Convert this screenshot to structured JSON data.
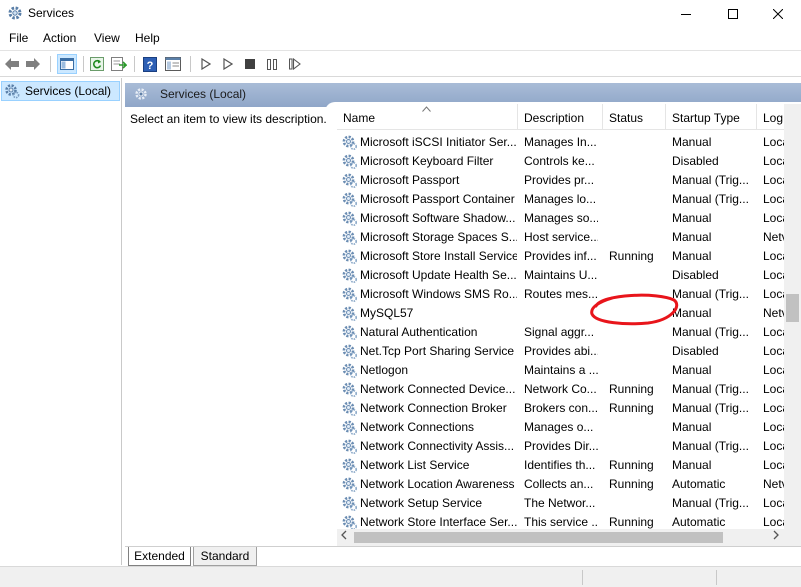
{
  "window": {
    "title": "Services",
    "controls": [
      "minimize",
      "maximize",
      "close"
    ]
  },
  "menu": {
    "items": [
      "File",
      "Action",
      "View",
      "Help"
    ]
  },
  "toolbar": {
    "icons": [
      "back-icon",
      "forward-icon",
      "show-hide-console-tree-icon",
      "refresh-icon",
      "export-list-icon",
      "help-icon",
      "properties-icon",
      "start-service-icon",
      "start-service-alt-icon",
      "stop-service-icon",
      "pause-service-icon",
      "restart-service-icon"
    ]
  },
  "tree": {
    "items": [
      {
        "label": "Services (Local)"
      }
    ]
  },
  "pane": {
    "header": "Services (Local)",
    "description": "Select an item to view its description."
  },
  "list": {
    "columns": [
      "Name",
      "Description",
      "Status",
      "Startup Type",
      "Log"
    ],
    "rows": [
      {
        "name": "Microsoft iSCSI Initiator Ser...",
        "description": "Manages In...",
        "status": "",
        "startup": "Manual",
        "log": "Loca"
      },
      {
        "name": "Microsoft Keyboard Filter",
        "description": "Controls ke...",
        "status": "",
        "startup": "Disabled",
        "log": "Loca"
      },
      {
        "name": "Microsoft Passport",
        "description": "Provides pr...",
        "status": "",
        "startup": "Manual (Trig...",
        "log": "Loca"
      },
      {
        "name": "Microsoft Passport Container",
        "description": "Manages lo...",
        "status": "",
        "startup": "Manual (Trig...",
        "log": "Loca"
      },
      {
        "name": "Microsoft Software Shadow...",
        "description": "Manages so...",
        "status": "",
        "startup": "Manual",
        "log": "Loca"
      },
      {
        "name": "Microsoft Storage Spaces S...",
        "description": "Host service...",
        "status": "",
        "startup": "Manual",
        "log": "Netv"
      },
      {
        "name": "Microsoft Store Install Service",
        "description": "Provides inf...",
        "status": "Running",
        "startup": "Manual",
        "log": "Loca"
      },
      {
        "name": "Microsoft Update Health Se...",
        "description": "Maintains U...",
        "status": "",
        "startup": "Disabled",
        "log": "Loca"
      },
      {
        "name": "Microsoft Windows SMS Ro...",
        "description": "Routes mes...",
        "status": "",
        "startup": "Manual (Trig...",
        "log": "Loca"
      },
      {
        "name": "MySQL57",
        "description": "",
        "status": "",
        "startup": "Manual",
        "log": "Netv"
      },
      {
        "name": "Natural Authentication",
        "description": "Signal aggr...",
        "status": "",
        "startup": "Manual (Trig...",
        "log": "Loca"
      },
      {
        "name": "Net.Tcp Port Sharing Service",
        "description": "Provides abi...",
        "status": "",
        "startup": "Disabled",
        "log": "Loca"
      },
      {
        "name": "Netlogon",
        "description": "Maintains a ...",
        "status": "",
        "startup": "Manual",
        "log": "Loca"
      },
      {
        "name": "Network Connected Device...",
        "description": "Network Co...",
        "status": "Running",
        "startup": "Manual (Trig...",
        "log": "Loca"
      },
      {
        "name": "Network Connection Broker",
        "description": "Brokers con...",
        "status": "Running",
        "startup": "Manual (Trig...",
        "log": "Loca"
      },
      {
        "name": "Network Connections",
        "description": "Manages o...",
        "status": "",
        "startup": "Manual",
        "log": "Loca"
      },
      {
        "name": "Network Connectivity Assis...",
        "description": "Provides Dir...",
        "status": "",
        "startup": "Manual (Trig...",
        "log": "Loca"
      },
      {
        "name": "Network List Service",
        "description": "Identifies th...",
        "status": "Running",
        "startup": "Manual",
        "log": "Loca"
      },
      {
        "name": "Network Location Awareness",
        "description": "Collects an...",
        "status": "Running",
        "startup": "Automatic",
        "log": "Netv"
      },
      {
        "name": "Network Setup Service",
        "description": "The Networ...",
        "status": "",
        "startup": "Manual (Trig...",
        "log": "Loca"
      },
      {
        "name": "Network Store Interface Ser...",
        "description": "This service ...",
        "status": "Running",
        "startup": "Automatic",
        "log": "Loca"
      }
    ]
  },
  "tabs": [
    "Extended",
    "Standard"
  ],
  "annotation": {
    "color": "#e8151b",
    "shape": "ellipse"
  }
}
